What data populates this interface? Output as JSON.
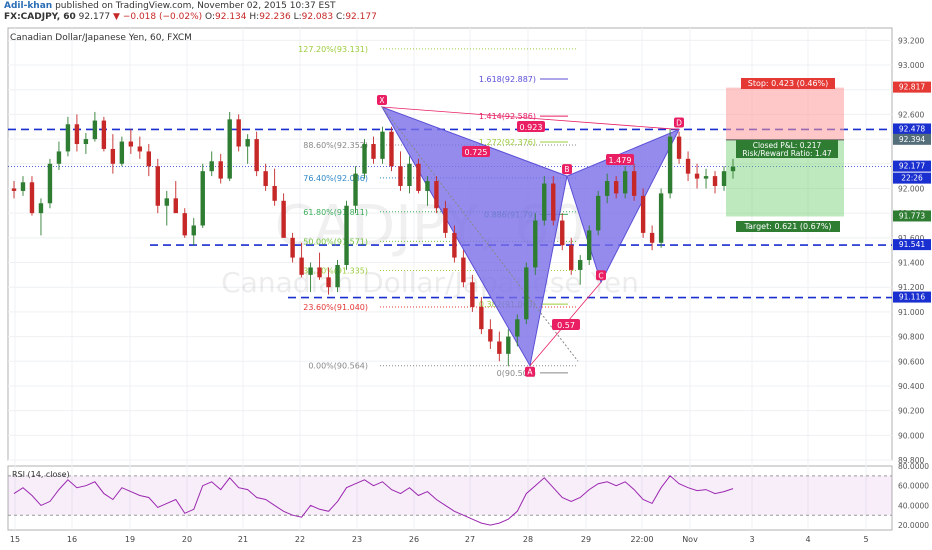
{
  "header": {
    "author": "Adil-khan",
    "published": "published on TradingView.com, November 02, 2015 10:37 EST",
    "symbol": "FX:CADJPY, 60",
    "last": "92.177",
    "change": "−0.018 (−0.02%)",
    "o_label": "O:",
    "o": "92.134",
    "h_label": "H:",
    "h": "92.236",
    "l_label": "L:",
    "l": "92.083",
    "c_label": "C:",
    "c": "92.177"
  },
  "chart_title": "Canadian Dollar/Japanese Yen, 60, FXCM",
  "watermark": {
    "ticker": "CADJPY, 60",
    "name": "Canadian Dollar/Japanese Yen"
  },
  "colors": {
    "up": "#2e7d32",
    "down": "#c62828",
    "pattern": "#5b4fd6",
    "pattern_fill": "#7b6ee8",
    "level": "#1a2fcf",
    "rsi": "#9c27b0",
    "fib_pink": "#e91e63",
    "target": "#6fcf6f",
    "stop": "#ff9a9a"
  },
  "chart_data": [
    {
      "type": "candlestick",
      "ylim": [
        89.8,
        93.3
      ],
      "x_ticks": [
        "15",
        "16",
        "19",
        "20",
        "21",
        "22",
        "23",
        "26",
        "27",
        "28",
        "29",
        "22:00",
        "Nov",
        "3",
        "4",
        "5"
      ],
      "y_ticks": [
        "93.200",
        "93.000",
        "92.800",
        "92.600",
        "92.400",
        "92.200",
        "92.000",
        "91.800",
        "91.600",
        "91.400",
        "91.200",
        "91.000",
        "90.800",
        "90.600",
        "90.400",
        "90.200",
        "90.000",
        "89.800"
      ],
      "price_badges": [
        {
          "value": "92.817",
          "color": "#e53935"
        },
        {
          "value": "92.478",
          "color": "#1a2fcf"
        },
        {
          "value": "92.394",
          "color": "#546e7a"
        },
        {
          "value": "92.177",
          "color": "#1a2fcf"
        },
        {
          "value": "22:26",
          "color": "#1a2fcf"
        },
        {
          "value": "91.773",
          "color": "#2e7d32"
        },
        {
          "value": "91.541",
          "color": "#1a2fcf"
        },
        {
          "value": "91.116",
          "color": "#1a2fcf"
        }
      ],
      "horizontal_levels": [
        92.478,
        91.541,
        91.116
      ],
      "harmonic_pattern": {
        "points": [
          {
            "label": "X",
            "price": 92.66
          },
          {
            "label": "A",
            "price": 90.564
          },
          {
            "label": "B",
            "price": 92.1
          },
          {
            "label": "C",
            "price": 91.24
          },
          {
            "label": "D",
            "price": 92.478
          }
        ],
        "ratios": [
          "0.725",
          "1.479",
          "0.57",
          "0.923"
        ]
      },
      "fib_retracement": [
        {
          "label": "127.20%(93.131)",
          "value": 93.131
        },
        {
          "label": "88.60%(92.352)",
          "value": 92.352
        },
        {
          "label": "76.40%(92.086)",
          "value": 92.086
        },
        {
          "label": "61.80%(91.811)",
          "value": 91.811
        },
        {
          "label": "50.00%(91.571)",
          "value": 91.571
        },
        {
          "label": "38.20%(91.335)",
          "value": 91.335
        },
        {
          "label": "23.60%(91.040)",
          "value": 91.04
        },
        {
          "label": "0.00%(90.564)",
          "value": 90.564
        }
      ],
      "fib_extension": [
        {
          "label": "1.618(92.887)",
          "value": 92.887
        },
        {
          "label": "1.414(92.586)",
          "value": 92.586
        },
        {
          "label": "1.272(92.376)",
          "value": 92.376
        },
        {
          "label": "0.886(91.79)",
          "value": 91.79
        },
        {
          "label": "0.382(91.063)",
          "value": 91.063
        },
        {
          "label": "0(90.506)",
          "value": 90.506
        }
      ],
      "position": {
        "entry": 92.394,
        "stop": 92.817,
        "target": 91.773,
        "stop_text": "Stop: 0.423 (0.46%)",
        "target_text": "Target: 0.621 (0.67%)",
        "pnl_text": "Closed P&L: 0.217",
        "rr_text": "Risk/Reward Ratio: 1.47"
      },
      "candles": [
        [
          92.0,
          92.06,
          91.92,
          91.98
        ],
        [
          91.98,
          92.1,
          91.94,
          92.05
        ],
        [
          92.05,
          92.1,
          91.78,
          91.8
        ],
        [
          91.8,
          91.92,
          91.62,
          91.88
        ],
        [
          91.88,
          92.24,
          91.84,
          92.2
        ],
        [
          92.2,
          92.38,
          92.15,
          92.3
        ],
        [
          92.3,
          92.58,
          92.26,
          92.52
        ],
        [
          92.52,
          92.6,
          92.3,
          92.36
        ],
        [
          92.36,
          92.45,
          92.28,
          92.4
        ],
        [
          92.4,
          92.62,
          92.38,
          92.55
        ],
        [
          92.55,
          92.58,
          92.3,
          92.32
        ],
        [
          92.32,
          92.44,
          92.12,
          92.2
        ],
        [
          92.2,
          92.42,
          92.18,
          92.38
        ],
        [
          92.38,
          92.48,
          92.28,
          92.34
        ],
        [
          92.34,
          92.42,
          92.24,
          92.3
        ],
        [
          92.3,
          92.36,
          92.1,
          92.18
        ],
        [
          92.18,
          92.24,
          91.8,
          91.86
        ],
        [
          91.86,
          91.98,
          91.7,
          91.92
        ],
        [
          91.92,
          92.06,
          91.86,
          91.8
        ],
        [
          91.8,
          91.84,
          91.6,
          91.62
        ],
        [
          91.62,
          91.76,
          91.54,
          91.7
        ],
        [
          91.7,
          92.2,
          91.68,
          92.14
        ],
        [
          92.14,
          92.3,
          92.1,
          92.22
        ],
        [
          92.22,
          92.28,
          92.04,
          92.08
        ],
        [
          92.08,
          92.62,
          92.06,
          92.56
        ],
        [
          92.56,
          92.6,
          92.3,
          92.34
        ],
        [
          92.34,
          92.44,
          92.2,
          92.4
        ],
        [
          92.4,
          92.46,
          92.1,
          92.14
        ],
        [
          92.14,
          92.2,
          91.98,
          92.02
        ],
        [
          92.02,
          92.16,
          91.86,
          91.9
        ],
        [
          91.9,
          91.96,
          91.66,
          91.6
        ],
        [
          91.6,
          91.64,
          91.4,
          91.44
        ],
        [
          91.44,
          91.56,
          91.28,
          91.3
        ],
        [
          91.3,
          91.4,
          91.16,
          91.36
        ],
        [
          91.36,
          91.48,
          91.26,
          91.28
        ],
        [
          91.28,
          91.36,
          91.14,
          91.2
        ],
        [
          91.2,
          91.42,
          91.16,
          91.38
        ],
        [
          91.38,
          91.9,
          91.34,
          91.86
        ],
        [
          91.86,
          92.18,
          91.8,
          92.12
        ],
        [
          92.12,
          92.4,
          92.08,
          92.36
        ],
        [
          92.36,
          92.42,
          92.2,
          92.24
        ],
        [
          92.24,
          92.5,
          92.2,
          92.46
        ],
        [
          92.46,
          92.5,
          92.14,
          92.18
        ],
        [
          92.18,
          92.3,
          91.98,
          92.02
        ],
        [
          92.02,
          92.26,
          91.96,
          92.2
        ],
        [
          92.2,
          92.24,
          91.96,
          91.98
        ],
        [
          91.98,
          92.1,
          91.86,
          92.06
        ],
        [
          92.06,
          92.1,
          91.8,
          91.84
        ],
        [
          91.84,
          91.9,
          91.6,
          91.64
        ],
        [
          91.64,
          91.7,
          91.4,
          91.44
        ],
        [
          91.44,
          91.5,
          91.2,
          91.24
        ],
        [
          91.24,
          91.3,
          91.0,
          91.04
        ],
        [
          91.04,
          91.12,
          90.82,
          90.86
        ],
        [
          90.86,
          90.94,
          90.7,
          90.76
        ],
        [
          90.76,
          90.84,
          90.6,
          90.66
        ],
        [
          90.66,
          90.86,
          90.56,
          90.8
        ],
        [
          90.8,
          90.98,
          90.72,
          90.94
        ],
        [
          90.94,
          91.4,
          90.9,
          91.36
        ],
        [
          91.36,
          91.8,
          91.3,
          91.74
        ],
        [
          91.74,
          92.1,
          91.7,
          92.04
        ],
        [
          92.04,
          92.1,
          91.7,
          91.74
        ],
        [
          91.74,
          91.8,
          91.5,
          91.54
        ],
        [
          91.54,
          91.6,
          91.3,
          91.34
        ],
        [
          91.34,
          91.46,
          91.22,
          91.42
        ],
        [
          91.42,
          91.7,
          91.38,
          91.66
        ],
        [
          91.66,
          91.98,
          91.62,
          91.94
        ],
        [
          91.94,
          92.12,
          91.88,
          92.06
        ],
        [
          92.06,
          92.1,
          91.92,
          91.96
        ],
        [
          91.96,
          92.18,
          91.92,
          92.14
        ],
        [
          92.14,
          92.2,
          91.9,
          91.94
        ],
        [
          91.94,
          92.0,
          91.6,
          91.64
        ],
        [
          91.64,
          91.7,
          91.5,
          91.56
        ],
        [
          91.56,
          92.0,
          91.52,
          91.96
        ],
        [
          91.96,
          92.48,
          91.92,
          92.42
        ],
        [
          92.42,
          92.46,
          92.2,
          92.24
        ],
        [
          92.24,
          92.3,
          92.06,
          92.12
        ],
        [
          92.12,
          92.2,
          92.0,
          92.08
        ],
        [
          92.08,
          92.16,
          92.0,
          92.1
        ],
        [
          92.1,
          92.14,
          91.96,
          92.02
        ],
        [
          92.02,
          92.18,
          91.98,
          92.14
        ],
        [
          92.14,
          92.24,
          92.08,
          92.177
        ]
      ]
    },
    {
      "type": "line",
      "title": "RSI (14, close)",
      "ylim": [
        15,
        80
      ],
      "y_ticks": [
        "80.0000",
        "60.0000",
        "40.0000",
        "20.0000"
      ],
      "bands": [
        70,
        30
      ],
      "values": [
        52,
        58,
        50,
        40,
        44,
        56,
        66,
        58,
        60,
        64,
        52,
        46,
        58,
        54,
        50,
        48,
        38,
        42,
        46,
        32,
        36,
        60,
        64,
        56,
        68,
        58,
        56,
        48,
        46,
        40,
        34,
        30,
        28,
        40,
        36,
        34,
        44,
        58,
        62,
        66,
        60,
        64,
        56,
        52,
        58,
        50,
        54,
        46,
        40,
        34,
        30,
        26,
        22,
        20,
        22,
        26,
        34,
        52,
        60,
        68,
        58,
        48,
        44,
        48,
        56,
        62,
        64,
        60,
        64,
        56,
        46,
        42,
        58,
        70,
        62,
        58,
        55,
        56,
        52,
        54,
        57
      ]
    }
  ]
}
